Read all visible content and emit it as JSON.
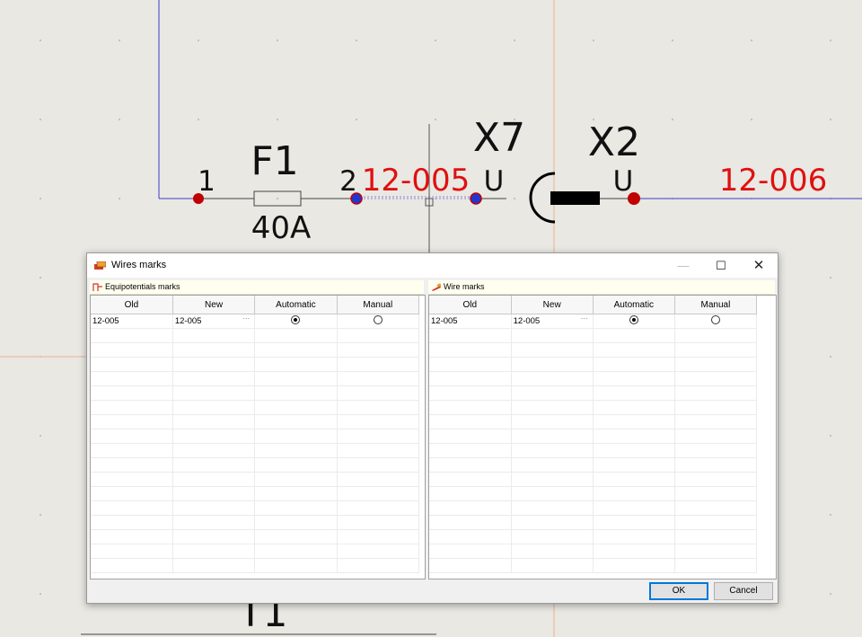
{
  "canvas": {
    "labels": {
      "f1": "F1",
      "rating": "40A",
      "pin1": "1",
      "pin2": "2",
      "x7": "X7",
      "x2": "X2",
      "u1": "U",
      "u2": "U",
      "mark1": "12-005",
      "mark2": "12-006",
      "t1": "T1"
    },
    "colors": {
      "wire": "#3b3bc8",
      "mark": "#e01010",
      "node": "#c00000",
      "node_selected": "#2038d0"
    }
  },
  "dialog": {
    "title": "Wires marks",
    "controls": {
      "minimize": "—",
      "maximize": "☐",
      "close": "✕"
    },
    "left_panel": {
      "header": "Equipotentials marks",
      "icon": "equipotential-icon",
      "columns": [
        "Old",
        "New",
        "Automatic",
        "Manual"
      ],
      "rows": [
        {
          "old": "12-005",
          "new": "12-005",
          "ellipsis": "···",
          "mode": "automatic"
        }
      ]
    },
    "right_panel": {
      "header": "Wire marks",
      "icon": "wire-marker-icon",
      "columns": [
        "Old",
        "New",
        "Automatic",
        "Manual"
      ],
      "rows": [
        {
          "old": "12-005",
          "new": "12-005",
          "ellipsis": "···",
          "mode": "automatic"
        }
      ]
    },
    "buttons": {
      "ok": "OK",
      "cancel": "Cancel"
    }
  }
}
